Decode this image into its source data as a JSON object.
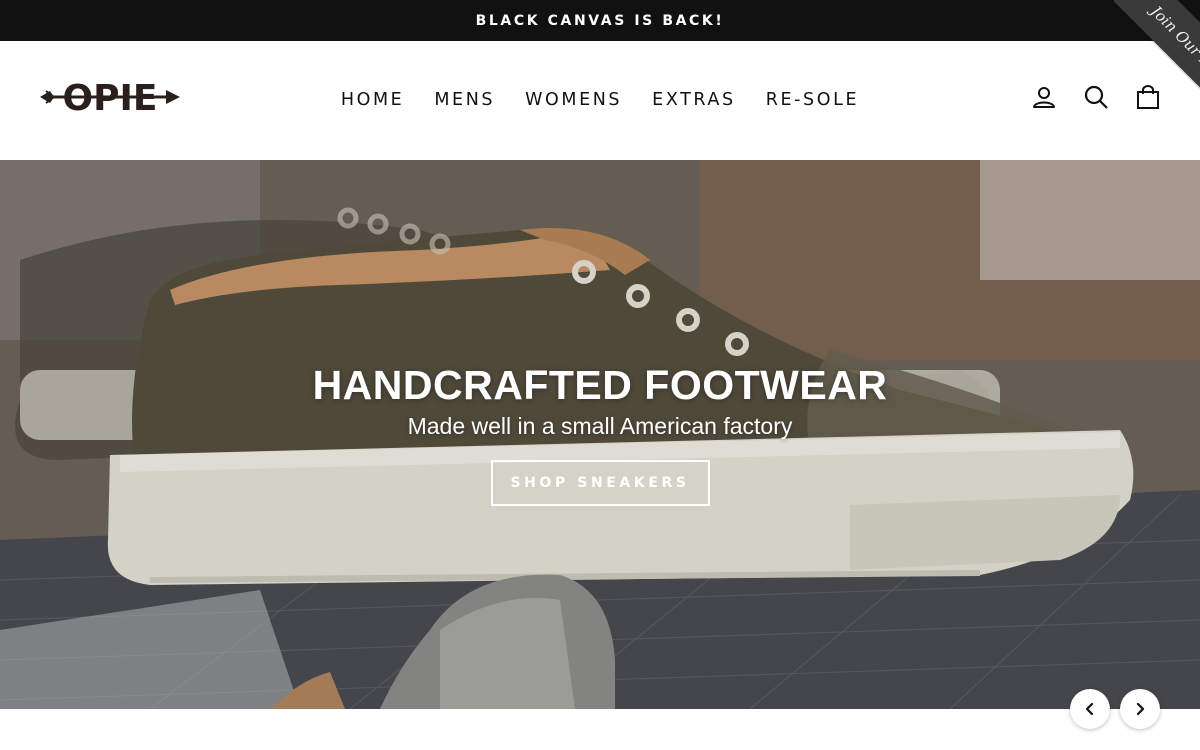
{
  "announcement": {
    "text": "BLACK CANVAS IS BACK!"
  },
  "ribbon": {
    "text": "Join Our List!"
  },
  "brand": {
    "logo_text": "OPIE"
  },
  "nav": {
    "items": [
      {
        "label": "HOME"
      },
      {
        "label": "MENS"
      },
      {
        "label": "WOMENS"
      },
      {
        "label": "EXTRAS"
      },
      {
        "label": "RE-SOLE"
      }
    ]
  },
  "header_icons": [
    "user-icon",
    "search-icon",
    "cart-icon"
  ],
  "hero": {
    "title": "HANDCRAFTED FOOTWEAR",
    "subtitle": "Made well in a small American factory",
    "cta_label": "SHOP SNEAKERS"
  },
  "slider": {
    "prev_icon": "chevron-left-icon",
    "next_icon": "chevron-right-icon"
  },
  "colors": {
    "announcement_bg": "#111111",
    "ribbon_bg": "#3a3a3a",
    "text": "#111111",
    "hero_overlay_text": "#ffffff"
  }
}
